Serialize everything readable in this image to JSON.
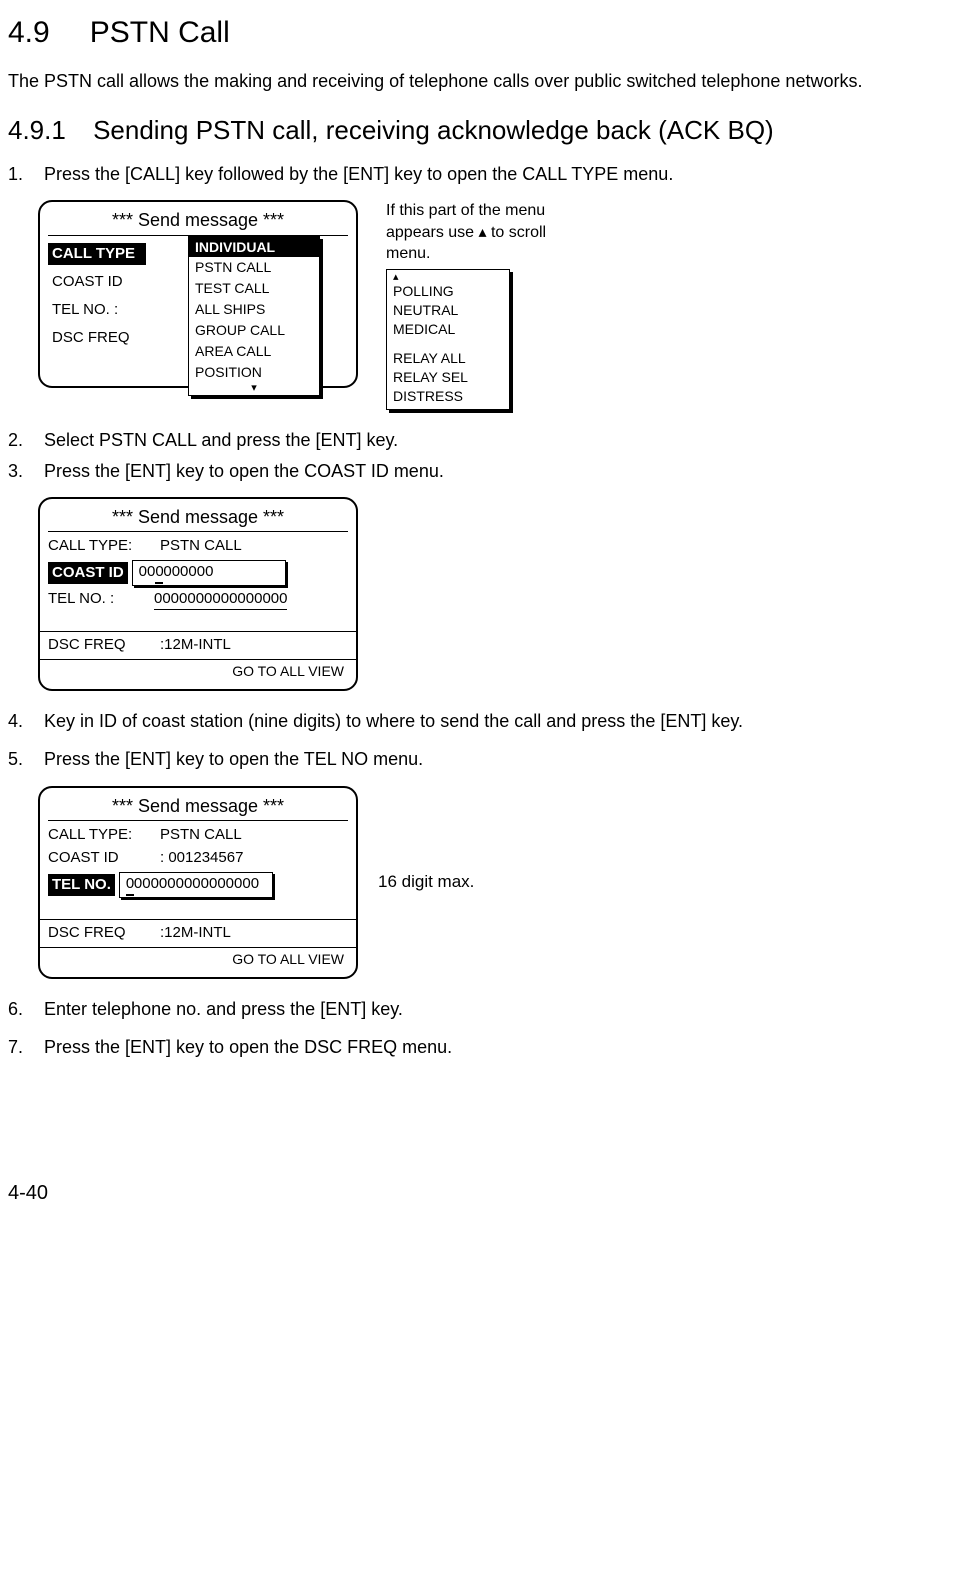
{
  "page_number": "4-40",
  "section": {
    "num": "4.9",
    "title": "PSTN Call"
  },
  "intro": "The PSTN call allows the making and receiving of telephone calls over public switched telephone networks.",
  "subsection": {
    "num": "4.9.1",
    "title": "Sending PSTN call, receiving acknowledge back (ACK BQ)"
  },
  "steps": {
    "s1": {
      "num": "1.",
      "text": "Press the [CALL] key followed by the [ENT] key to open the CALL TYPE menu."
    },
    "s2": {
      "num": "2.",
      "text": "Select PSTN CALL and press the [ENT] key."
    },
    "s3": {
      "num": "3.",
      "text": "Press the [ENT] key to open the COAST ID menu."
    },
    "s4": {
      "num": "4.",
      "text": "Key in ID of coast station (nine digits) to where to send the call and press the [ENT] key."
    },
    "s5": {
      "num": "5.",
      "text": "Press the [ENT] key to open the TEL NO menu."
    },
    "s6": {
      "num": "6.",
      "text": "Enter telephone no. and press the [ENT] key."
    },
    "s7": {
      "num": "7.",
      "text": "Press the [ENT] key to open the DSC FREQ menu."
    }
  },
  "panel_title": "*** Send message ***",
  "fig1": {
    "left_labels": {
      "call_type": "CALL TYPE",
      "coast_id": "COAST ID",
      "tel_no": "TEL NO. :",
      "dsc_freq": "DSC FREQ"
    },
    "dropdown": [
      "INDIVIDUAL",
      "PSTN CALL",
      "TEST CALL",
      "ALL SHIPS",
      "GROUP CALL",
      "AREA CALL",
      "POSITION"
    ],
    "hint_top": "If this part of the menu appears use ▴ to scroll menu.",
    "side_list_top": [
      "POLLING",
      "NEUTRAL",
      "MEDICAL"
    ],
    "side_list_bottom": [
      "RELAY ALL",
      "RELAY SEL",
      "DISTRESS"
    ]
  },
  "fig2": {
    "call_type_label": "CALL TYPE:",
    "call_type_value": "PSTN CALL",
    "coast_id_label": "COAST ID",
    "coast_id_value_prefix": "00",
    "coast_id_value_cursor": "0",
    "coast_id_value_rest": "000000",
    "tel_no_label": "TEL NO. :",
    "tel_no_value": "0000000000000000",
    "dsc_freq_label": "DSC FREQ",
    "dsc_freq_value": ":12M-INTL",
    "go_all": "GO TO ALL VIEW"
  },
  "fig3": {
    "call_type_label": "CALL TYPE:",
    "call_type_value": "PSTN CALL",
    "coast_id_label": "COAST ID",
    "coast_id_value": ": 001234567",
    "tel_no_label": "TEL NO.",
    "tel_no_value_cursor": "0",
    "tel_no_value_rest": "000000000000000",
    "dsc_freq_label": "DSC FREQ",
    "dsc_freq_value": ":12M-INTL",
    "go_all": "GO TO ALL VIEW",
    "note": "16 digit max."
  }
}
